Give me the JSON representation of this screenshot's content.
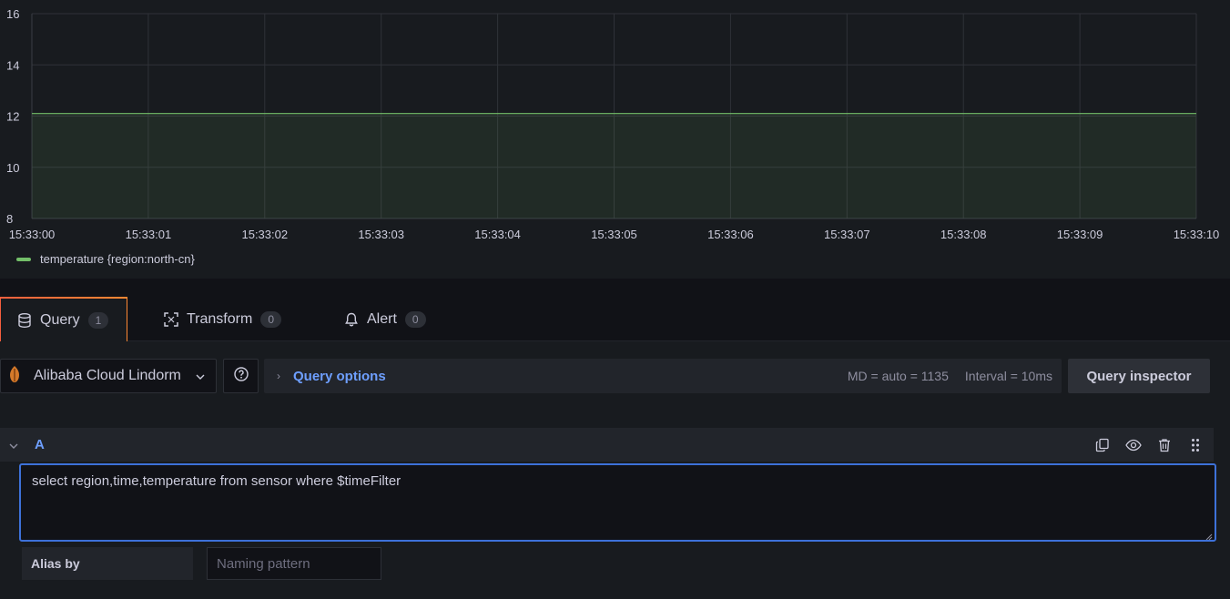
{
  "colors": {
    "series": "#73bf69",
    "accent_blue": "#6e9fff",
    "tab_accent": "#f55f3e",
    "focus_border": "#3d71d9"
  },
  "chart_data": {
    "type": "area",
    "x": [
      "15:33:00",
      "15:33:01",
      "15:33:02",
      "15:33:03",
      "15:33:04",
      "15:33:05",
      "15:33:06",
      "15:33:07",
      "15:33:08",
      "15:33:09",
      "15:33:10"
    ],
    "y_ticks": [
      "8",
      "10",
      "12",
      "14",
      "16"
    ],
    "ylim": [
      8,
      16
    ],
    "grid": true,
    "series": [
      {
        "name": "temperature {region:north-cn}",
        "values": [
          12.1,
          12.1,
          12.1,
          12.1,
          12.1,
          12.1,
          12.1,
          12.1,
          12.1,
          12.1,
          12.1
        ]
      }
    ],
    "legend_position": "bottom-left"
  },
  "tabs": [
    {
      "label": "Query",
      "count": "1",
      "icon": "database-icon",
      "active": true
    },
    {
      "label": "Transform",
      "count": "0",
      "icon": "transform-icon",
      "active": false
    },
    {
      "label": "Alert",
      "count": "0",
      "icon": "bell-icon",
      "active": false
    }
  ],
  "datasource": {
    "name": "Alibaba Cloud Lindorm",
    "icon": "lindorm-icon"
  },
  "query_options": {
    "title": "Query options",
    "md": "MD = auto = 1135",
    "interval": "Interval = 10ms"
  },
  "query_inspector_label": "Query inspector",
  "query_row": {
    "ref_id": "A",
    "sql": "select region,time,temperature from sensor where $timeFilter"
  },
  "alias": {
    "label": "Alias by",
    "placeholder": "Naming pattern",
    "value": ""
  }
}
